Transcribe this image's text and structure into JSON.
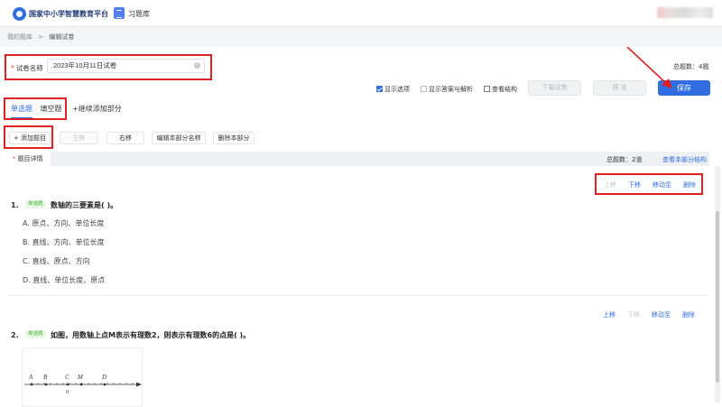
{
  "header": {
    "site_name": "国家中小学智慧教育平台",
    "module_title": "习题库"
  },
  "breadcrumb": {
    "root": "我的题库",
    "sep": ">",
    "current": "编辑试卷"
  },
  "paper": {
    "name_label": "试卷名称",
    "name_value": "2023年10月11日试卷",
    "total_label": "总题数：4题"
  },
  "options": {
    "show_options": "显示选项",
    "show_options_checked": true,
    "show_answer": "显示答案与解析",
    "show_answer_checked": false,
    "view_structure": "查看结构"
  },
  "buttons": {
    "download": "下载试卷",
    "preview": "预 览",
    "save": "保存"
  },
  "tabs": [
    {
      "label": "单选题",
      "active": true
    },
    {
      "label": "填空题",
      "active": false
    }
  ],
  "add_part": "+继续添加部分",
  "section_buttons": {
    "add_question": "+ 添加题目",
    "move_left": "左移",
    "move_right": "右移",
    "edit_name": "编辑本部分名称",
    "delete_part": "删除本部分"
  },
  "detail": {
    "title": "题目详情",
    "total": "总题数：2道",
    "view_structure": "查看本部分结构"
  },
  "question_actions": {
    "up": "上移",
    "down": "下移",
    "move_to": "移动至",
    "delete": "删除"
  },
  "questions": [
    {
      "number": "1.",
      "type": "单选题",
      "stem": "数轴的三要素是(      )。",
      "options": [
        "A. 原点、方向、单位长度",
        "B. 直线、方向、单位长度",
        "C. 直线、原点、方向",
        "D. 直线、单位长度、原点"
      ]
    },
    {
      "number": "2.",
      "type": "单选题",
      "stem": "如图，用数轴上点M表示有理数2，则表示有理数6的点是(      )。",
      "figure_labels": [
        "A",
        "B",
        "C",
        "M",
        "D"
      ],
      "figure_zero": "0"
    }
  ],
  "colors": {
    "primary": "#2f6de1",
    "highlight": "#e02020",
    "badge": "#48b13a"
  }
}
